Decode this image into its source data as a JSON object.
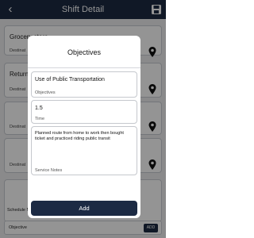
{
  "header": {
    "title": "Shift Detail",
    "back_icon": "chevron-left-icon",
    "save_icon": "save-icon"
  },
  "background": {
    "card1_title": "Grocery store",
    "card1_sub": "Destinat",
    "card2_title": "Return",
    "card2_sub": "Destinat",
    "card3_sub": "Destinat",
    "card4_sub": "Destinat",
    "schedule_notes_label": "Schedule Notes",
    "objective_label": "Objective",
    "add_small_label": "ADD"
  },
  "modal": {
    "title": "Objectives",
    "objectives_value": "Use of Public Transportation",
    "objectives_label": "Objectives",
    "time_value": "1.5",
    "time_label": "Time",
    "notes_value": "Planned route from home to work then bought ticket and practiced riding public transit",
    "notes_label": "Service Notes",
    "add_label": "Add"
  },
  "colors": {
    "primary": "#1c2a43",
    "overlay": "rgba(0,0,0,0.42)"
  }
}
